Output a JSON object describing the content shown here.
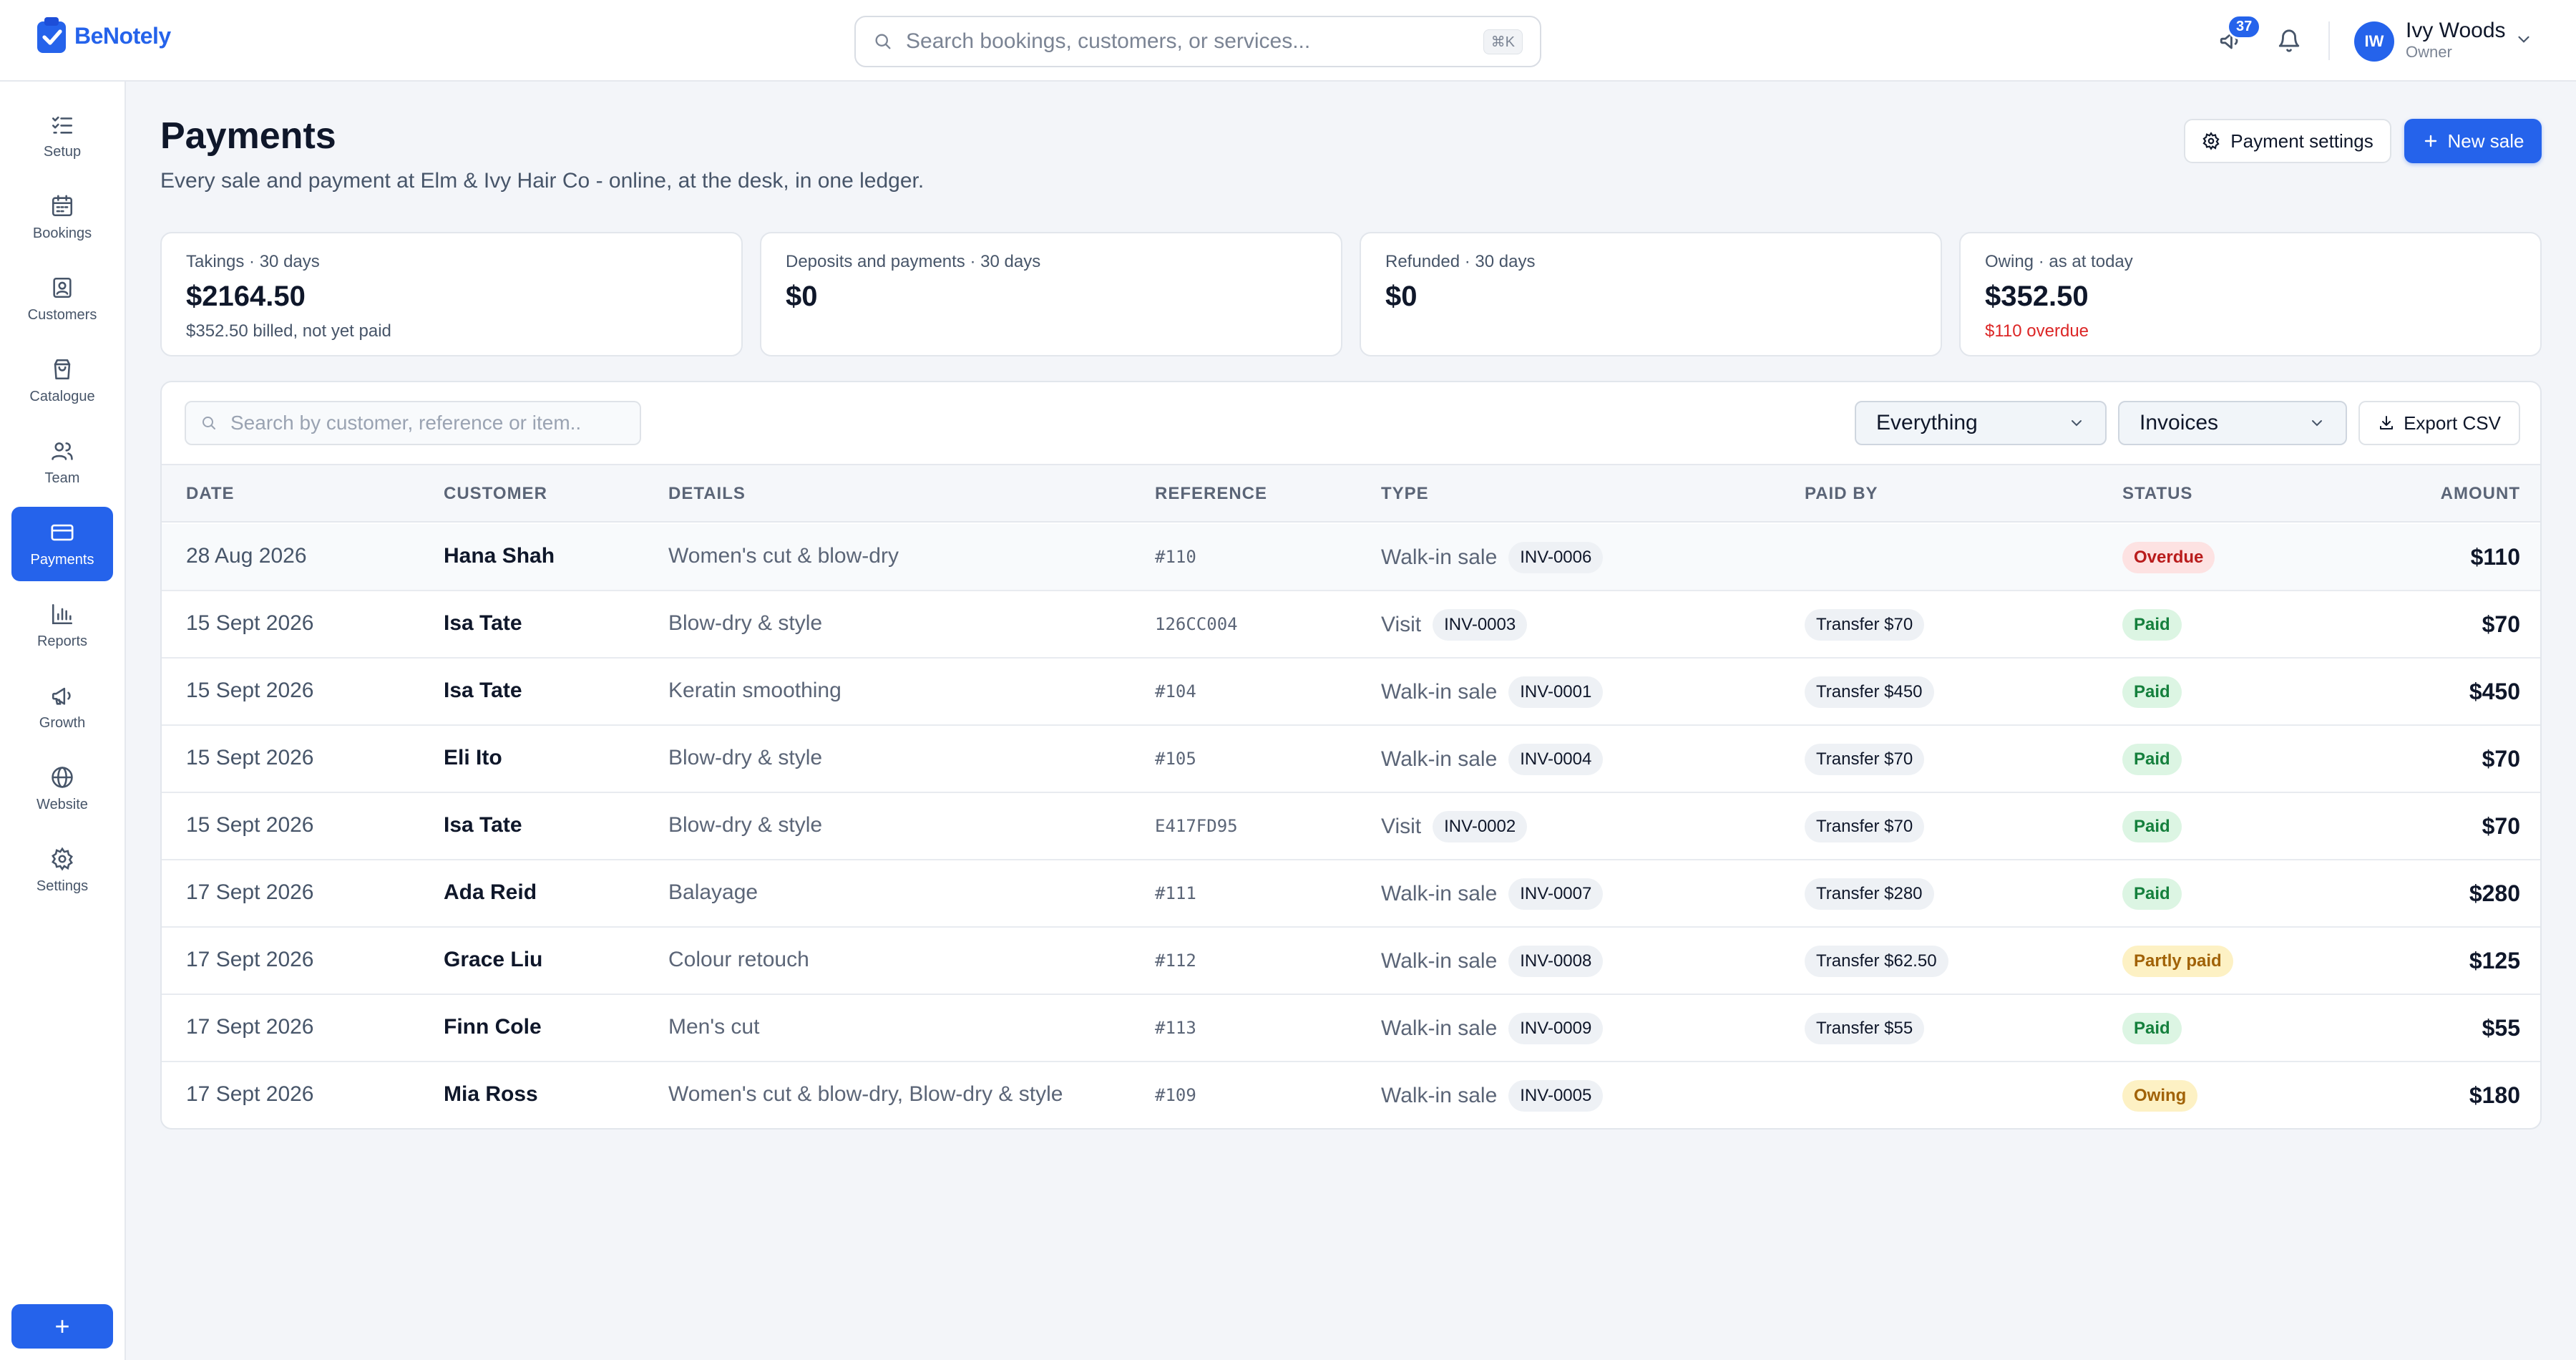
{
  "app": {
    "brand": "BeNotely"
  },
  "header": {
    "search_placeholder": "Search bookings, customers, or services...",
    "search_shortcut": "⌘K",
    "notification_count": "37",
    "user": {
      "initials": "IW",
      "name": "Ivy Woods",
      "role": "Owner"
    }
  },
  "sidebar": {
    "items": [
      {
        "label": "Setup",
        "icon": "checklist-icon"
      },
      {
        "label": "Bookings",
        "icon": "calendar-icon"
      },
      {
        "label": "Customers",
        "icon": "contact-icon"
      },
      {
        "label": "Catalogue",
        "icon": "shopping-bag-icon"
      },
      {
        "label": "Team",
        "icon": "team-icon"
      },
      {
        "label": "Payments",
        "icon": "credit-card-icon",
        "active": true
      },
      {
        "label": "Reports",
        "icon": "bar-chart-icon"
      },
      {
        "label": "Growth",
        "icon": "megaphone-icon"
      },
      {
        "label": "Website",
        "icon": "globe-icon"
      },
      {
        "label": "Settings",
        "icon": "gear-icon"
      }
    ],
    "add_label": "+"
  },
  "page": {
    "title": "Payments",
    "subtitle": "Every sale and payment at Elm & Ivy Hair Co - online, at the desk, in one ledger.",
    "settings_button": "Payment settings",
    "new_sale_button": "New sale"
  },
  "stats": [
    {
      "label": "Takings · 30 days",
      "value": "$2164.50",
      "sub": "$352.50 billed, not yet paid",
      "sub_color": "muted"
    },
    {
      "label": "Deposits and payments · 30 days",
      "value": "$0",
      "sub": "",
      "sub_color": "muted"
    },
    {
      "label": "Refunded · 30 days",
      "value": "$0",
      "sub": "",
      "sub_color": "muted"
    },
    {
      "label": "Owing · as at today",
      "value": "$352.50",
      "sub": "$110 overdue",
      "sub_color": "red"
    }
  ],
  "table": {
    "search_placeholder": "Search by customer, reference or item..",
    "filter_scope": "Everything",
    "filter_kind": "Invoices",
    "export_label": "Export CSV",
    "columns": [
      "DATE",
      "CUSTOMER",
      "DETAILS",
      "REFERENCE",
      "TYPE",
      "PAID BY",
      "STATUS",
      "AMOUNT"
    ],
    "rows": [
      {
        "date": "28 Aug 2026",
        "customer": "Hana Shah",
        "details": "Women's cut & blow-dry",
        "reference": "#110",
        "type": "Walk-in sale",
        "invoice": "INV-0006",
        "paid_by": "",
        "status": "Overdue",
        "status_kind": "overdue",
        "amount": "$110"
      },
      {
        "date": "15 Sept 2026",
        "customer": "Isa Tate",
        "details": "Blow-dry & style",
        "reference": "126CC004",
        "type": "Visit",
        "invoice": "INV-0003",
        "paid_by": "Transfer $70",
        "status": "Paid",
        "status_kind": "paid",
        "amount": "$70"
      },
      {
        "date": "15 Sept 2026",
        "customer": "Isa Tate",
        "details": "Keratin smoothing",
        "reference": "#104",
        "type": "Walk-in sale",
        "invoice": "INV-0001",
        "paid_by": "Transfer $450",
        "status": "Paid",
        "status_kind": "paid",
        "amount": "$450"
      },
      {
        "date": "15 Sept 2026",
        "customer": "Eli Ito",
        "details": "Blow-dry & style",
        "reference": "#105",
        "type": "Walk-in sale",
        "invoice": "INV-0004",
        "paid_by": "Transfer $70",
        "status": "Paid",
        "status_kind": "paid",
        "amount": "$70"
      },
      {
        "date": "15 Sept 2026",
        "customer": "Isa Tate",
        "details": "Blow-dry & style",
        "reference": "E417FD95",
        "type": "Visit",
        "invoice": "INV-0002",
        "paid_by": "Transfer $70",
        "status": "Paid",
        "status_kind": "paid",
        "amount": "$70"
      },
      {
        "date": "17 Sept 2026",
        "customer": "Ada Reid",
        "details": "Balayage",
        "reference": "#111",
        "type": "Walk-in sale",
        "invoice": "INV-0007",
        "paid_by": "Transfer $280",
        "status": "Paid",
        "status_kind": "paid",
        "amount": "$280"
      },
      {
        "date": "17 Sept 2026",
        "customer": "Grace Liu",
        "details": "Colour retouch",
        "reference": "#112",
        "type": "Walk-in sale",
        "invoice": "INV-0008",
        "paid_by": "Transfer $62.50",
        "status": "Partly paid",
        "status_kind": "partly",
        "amount": "$125"
      },
      {
        "date": "17 Sept 2026",
        "customer": "Finn Cole",
        "details": "Men's cut",
        "reference": "#113",
        "type": "Walk-in sale",
        "invoice": "INV-0009",
        "paid_by": "Transfer $55",
        "status": "Paid",
        "status_kind": "paid",
        "amount": "$55"
      },
      {
        "date": "17 Sept 2026",
        "customer": "Mia Ross",
        "details": "Women's cut & blow-dry, Blow-dry & style",
        "reference": "#109",
        "type": "Walk-in sale",
        "invoice": "INV-0005",
        "paid_by": "",
        "status": "Owing",
        "status_kind": "owing",
        "amount": "$180"
      }
    ]
  },
  "colors": {
    "accent": "#2563eb",
    "paid": "#15803d",
    "overdue": "#b91c1c",
    "partly": "#a16207"
  }
}
